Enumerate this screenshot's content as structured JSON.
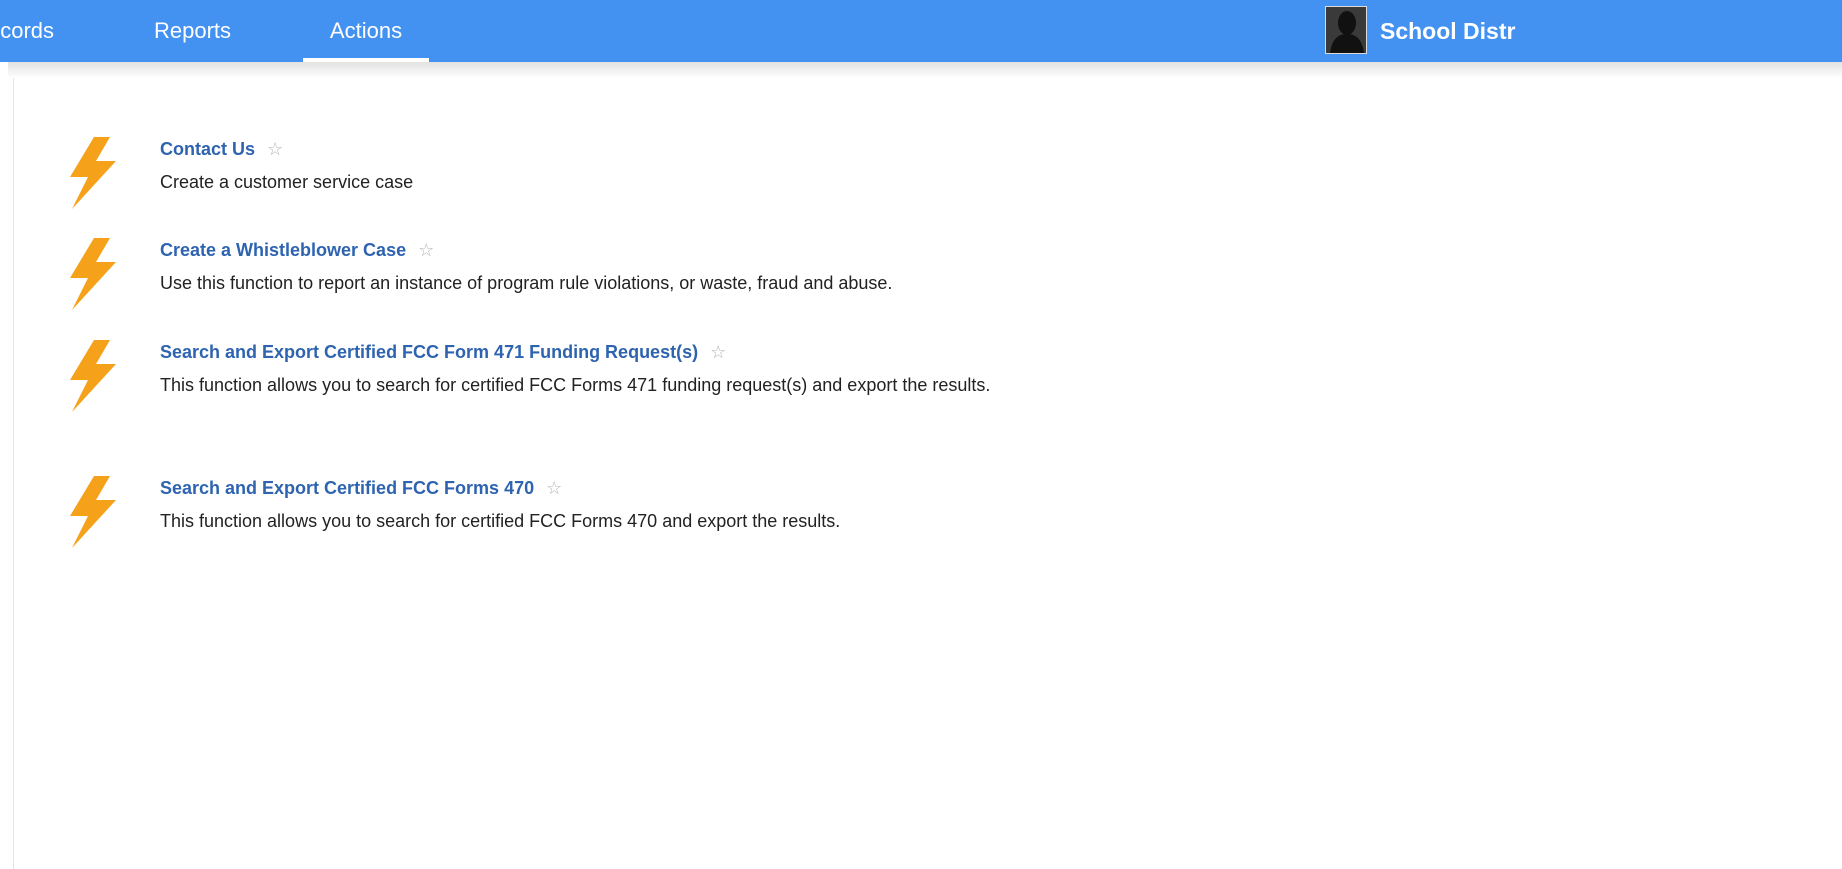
{
  "nav": {
    "tabs": [
      {
        "label": "ecords"
      },
      {
        "label": "Reports"
      },
      {
        "label": "Actions",
        "active": true
      }
    ],
    "org_name": "School Distr",
    "avatar_icon": "user-photo"
  },
  "colors": {
    "header_bg": "#4392f1",
    "link": "#2e63b0",
    "bolt": "#f6a11a"
  },
  "actions": [
    {
      "title": "Contact Us",
      "description": "Create a customer service case",
      "icon": "lightning-bolt-icon",
      "favorite_icon": "star-outline-icon"
    },
    {
      "title": "Create a Whistleblower Case",
      "description": "Use this function to report an instance of program rule violations, or waste, fraud and abuse.",
      "icon": "lightning-bolt-icon",
      "favorite_icon": "star-outline-icon"
    },
    {
      "title": "Search and Export Certified FCC Form 471 Funding Request(s)",
      "description": "This function allows you to search for certified FCC Forms 471 funding request(s) and export the results.",
      "icon": "lightning-bolt-icon",
      "favorite_icon": "star-outline-icon"
    },
    {
      "title": "Search and Export Certified FCC Forms 470",
      "description": "This function allows you to search for certified FCC Forms 470 and export the results.",
      "icon": "lightning-bolt-icon",
      "favorite_icon": "star-outline-icon"
    }
  ]
}
